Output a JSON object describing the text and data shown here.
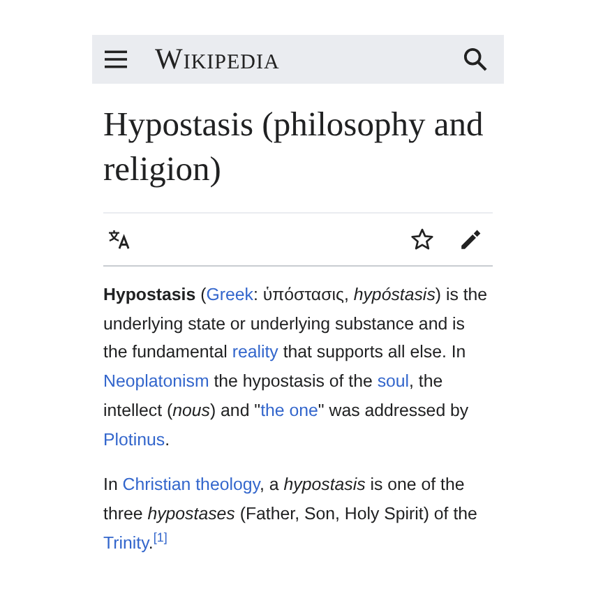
{
  "header": {
    "logo": "Wikipedia"
  },
  "article": {
    "title": "Hypostasis (philosophy and religion)",
    "paragraphs": [
      [
        {
          "kind": "text",
          "text": "**Hypostasis** ("
        },
        {
          "kind": "link",
          "text": "Greek"
        },
        {
          "kind": "text",
          "text": ": ὑπόστασις, *hypóstasis*) is the underlying state or underlying substance and is the fundamental "
        },
        {
          "kind": "link",
          "text": "reality"
        },
        {
          "kind": "text",
          "text": " that supports all else. In "
        },
        {
          "kind": "link",
          "text": "Neoplatonism"
        },
        {
          "kind": "text",
          "text": " the hypostasis of the "
        },
        {
          "kind": "link",
          "text": "soul"
        },
        {
          "kind": "text",
          "text": ", the intellect (*nous*) and \""
        },
        {
          "kind": "link",
          "text": "the one"
        },
        {
          "kind": "text",
          "text": "\" was addressed by "
        },
        {
          "kind": "link",
          "text": "Plotinus"
        },
        {
          "kind": "text",
          "text": "."
        }
      ],
      [
        {
          "kind": "text",
          "text": "In "
        },
        {
          "kind": "link",
          "text": "Christian theology"
        },
        {
          "kind": "text",
          "text": ", a *hypostasis* is one of the three *hypostases* (Father, Son, Holy Spirit) of the "
        },
        {
          "kind": "link",
          "text": "Trinity"
        },
        {
          "kind": "text",
          "text": "."
        },
        {
          "kind": "ref",
          "text": "[1]"
        }
      ]
    ]
  }
}
